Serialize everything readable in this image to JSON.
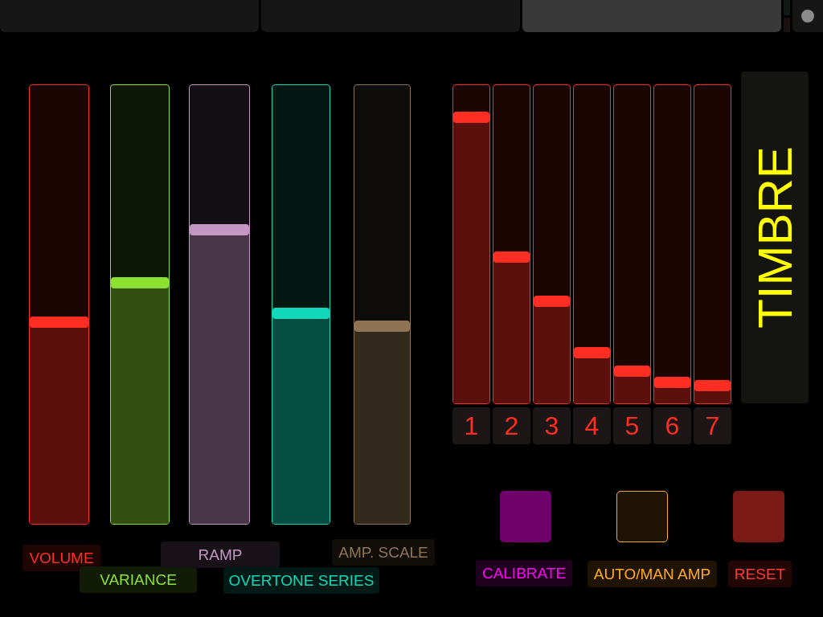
{
  "tabs": [
    {
      "selected": false
    },
    {
      "selected": false
    },
    {
      "selected": true
    }
  ],
  "sliders": [
    {
      "label": "VOLUME",
      "color": "#ff2d22",
      "level": 0.46
    },
    {
      "label": "VARIANCE",
      "color": "#8be030",
      "level": 0.55
    },
    {
      "label": "RAMP",
      "color": "#c496c4",
      "level": 0.67
    },
    {
      "label": "OVERTONE SERIES",
      "color": "#10d8b8",
      "level": 0.48
    },
    {
      "label": "AMP. SCALE",
      "color": "#8e7454",
      "level": 0.45
    }
  ],
  "harmonics": {
    "title": "TIMBRE",
    "color": "#ff2d22",
    "items": [
      {
        "label": "1",
        "level": 0.9
      },
      {
        "label": "2",
        "level": 0.46
      },
      {
        "label": "3",
        "level": 0.32
      },
      {
        "label": "4",
        "level": 0.16
      },
      {
        "label": "5",
        "level": 0.1
      },
      {
        "label": "6",
        "level": 0.065
      },
      {
        "label": "7",
        "level": 0.055
      }
    ]
  },
  "buttons": [
    {
      "label": "CALIBRATE",
      "color": "#70006a",
      "kind": "push"
    },
    {
      "label": "AUTO/MAN AMP",
      "color": "#ffaa1c",
      "kind": "toggle",
      "on": false
    },
    {
      "label": "RESET",
      "color": "#7a1a16",
      "kind": "push"
    }
  ]
}
